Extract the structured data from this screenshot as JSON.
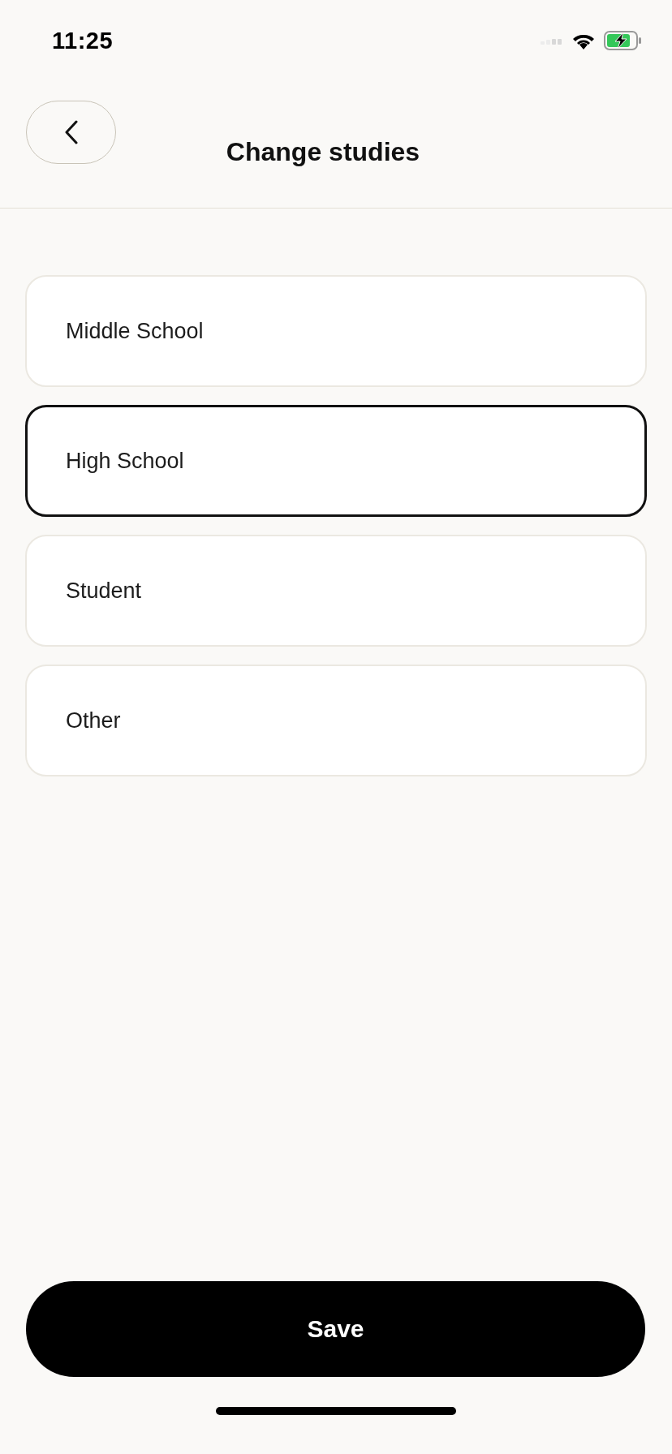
{
  "status_bar": {
    "time": "11:25"
  },
  "header": {
    "title": "Change studies"
  },
  "options": [
    {
      "label": "Middle School",
      "selected": false
    },
    {
      "label": "High School",
      "selected": true
    },
    {
      "label": "Student",
      "selected": false
    },
    {
      "label": "Other",
      "selected": false
    }
  ],
  "save_button": {
    "label": "Save"
  }
}
